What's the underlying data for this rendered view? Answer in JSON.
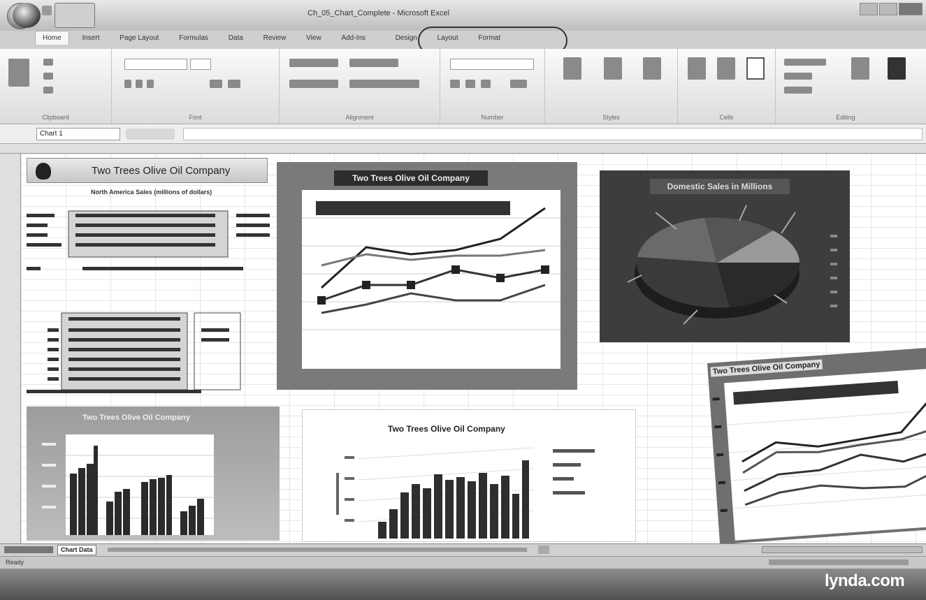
{
  "window": {
    "title": "Ch_05_Chart_Complete - Microsoft Excel"
  },
  "ribbon": {
    "tabs": [
      "Home",
      "Insert",
      "Page Layout",
      "Formulas",
      "Data",
      "Review",
      "View",
      "Add-Ins",
      "Design",
      "Layout",
      "Format"
    ],
    "active_tab": "Home",
    "groups": [
      "Clipboard",
      "Font",
      "Alignment",
      "Number",
      "Styles",
      "Cells",
      "Editing"
    ]
  },
  "formula_bar": {
    "name_box": "Chart 1"
  },
  "sheet": {
    "banner_title": "Two Trees Olive Oil Company",
    "subtitle": "North America Sales (millions of dollars)"
  },
  "charts": {
    "line_title": "Two Trees Olive Oil Company",
    "pie_title": "Domestic Sales in Millions",
    "bar_title": "Two Trees Olive Oil Company",
    "column3d_title": "Two Trees Olive Oil Company",
    "tilted_title": "Two Trees Olive Oil Company"
  },
  "sheet_tabs": {
    "active": "Chart Data"
  },
  "status": {
    "left": "Ready"
  },
  "watermark": "lynda.com"
}
